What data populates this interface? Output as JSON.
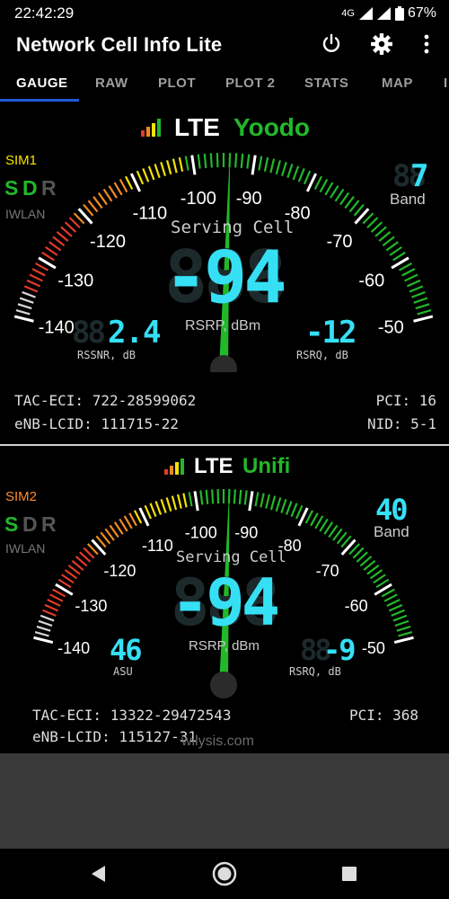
{
  "status_bar": {
    "time": "22:42:29",
    "network": "4G",
    "battery": "67%"
  },
  "app_bar": {
    "title": "Network Cell Info Lite",
    "power_icon": "power-icon",
    "settings_icon": "gear-icon",
    "overflow_icon": "more-vert-icon"
  },
  "tabs": [
    {
      "label": "GAUGE",
      "active": true
    },
    {
      "label": "RAW"
    },
    {
      "label": "PLOT"
    },
    {
      "label": "PLOT 2"
    },
    {
      "label": "STATS"
    },
    {
      "label": "MAP"
    },
    {
      "label": "I"
    }
  ],
  "scale_labels": [
    "-140",
    "-130",
    "-120",
    "-110",
    "-100",
    "-90",
    "-80",
    "-70",
    "-60",
    "-50"
  ],
  "sim1": {
    "tech": "LTE",
    "operator": "Yoodo",
    "sim_label": "SIM1",
    "sdr": [
      "S",
      "D",
      "R"
    ],
    "iwlan": "IWLAN",
    "band_value": "7",
    "band_ghost": "88",
    "band_label": "Band",
    "serving": "Serving Cell",
    "main_value": "-94",
    "main_ghost": "888",
    "unit": "RSRP, dBm",
    "left_value": "2.4",
    "left_ghost": "88",
    "left_label": "RSSNR, dB",
    "right_value": "-12",
    "right_ghost": "8",
    "right_label": "RSRQ, dB",
    "tac_eci": "TAC-ECI: 722-28599062",
    "enb_lcid": "eNB-LCID: 111715-22",
    "pci": "PCI: 16",
    "nid": "NID: 5-1",
    "needle_value": -94
  },
  "sim2": {
    "tech": "LTE",
    "operator": "Unifi",
    "sim_label": "SIM2",
    "sdr": [
      "S",
      "D",
      "R"
    ],
    "iwlan": "IWLAN",
    "band_value": "40",
    "band_ghost": "",
    "band_label": "Band",
    "serving": "Serving Cell",
    "main_value": "-94",
    "main_ghost": "888",
    "unit": "RSRP, dBm",
    "left_value": "46",
    "left_ghost": "",
    "left_label": "ASU",
    "right_value": "-9",
    "right_ghost": "88",
    "right_label": "RSRQ, dB",
    "tac_eci": "TAC-ECI: 13322-29472543",
    "enb_lcid": "eNB-LCID: 115127-31",
    "pci": "PCI: 368",
    "nid": "",
    "needle_value": -94
  },
  "watermark": "wilysis.com",
  "colors": {
    "green": "#22b82a",
    "cyan": "#35e0f5",
    "yellow": "#f5e300",
    "sim2_orange": "#ff8a2a",
    "tab_indicator": "#1e5bd8"
  },
  "nav_bar": {
    "back_icon": "back-triangle-icon",
    "home_icon": "home-circle-icon",
    "recents_icon": "recents-square-icon"
  }
}
